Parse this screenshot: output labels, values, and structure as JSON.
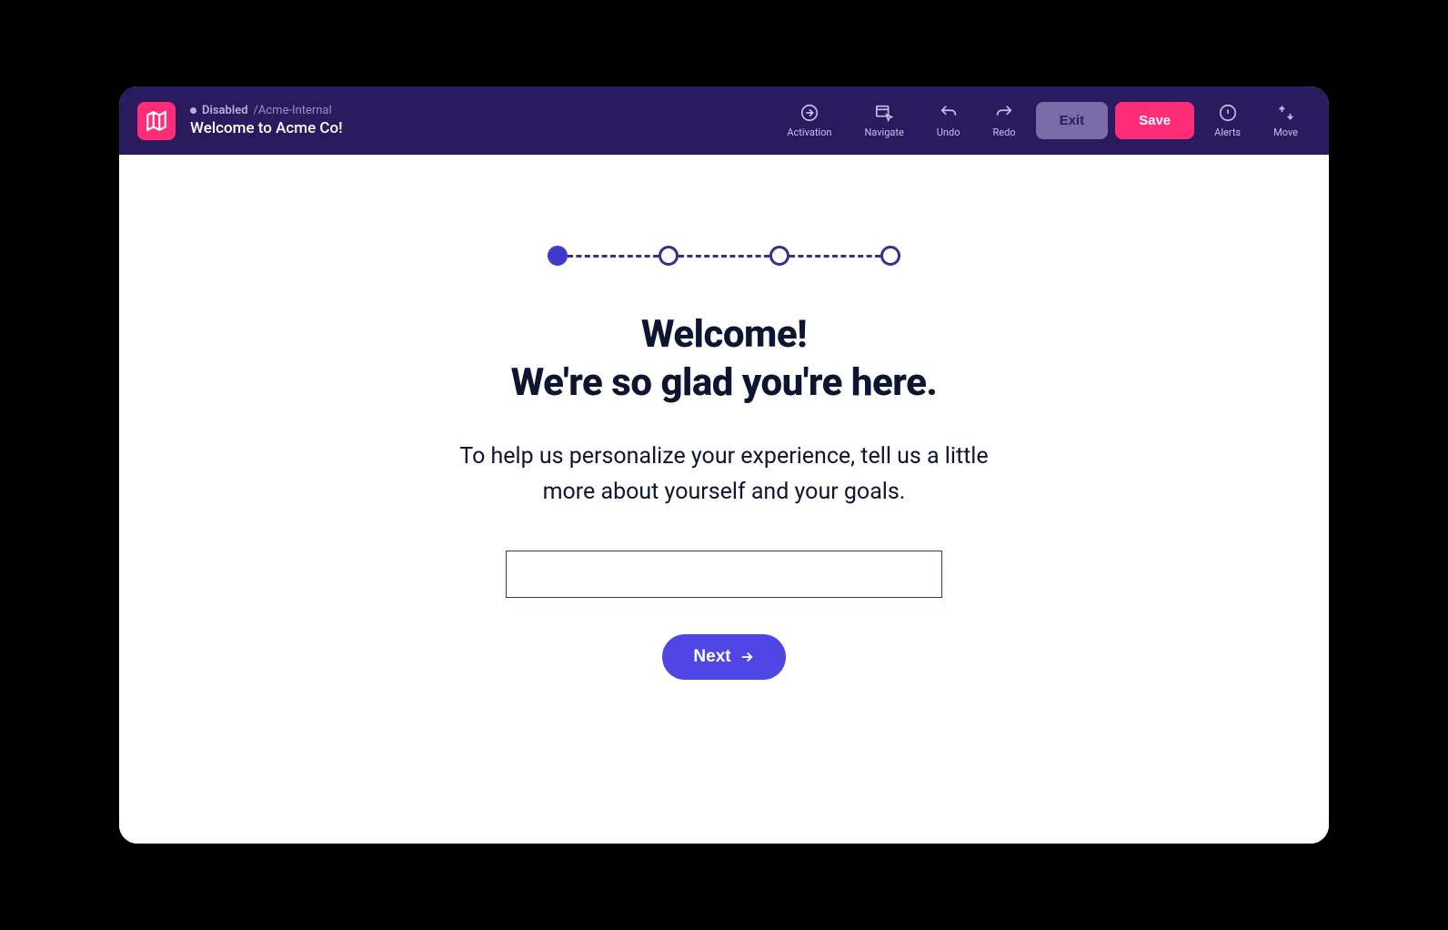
{
  "header": {
    "status_label": "Disabled",
    "breadcrumb": "/Acme-Internal",
    "page_title": "Welcome to Acme Co!"
  },
  "toolbar": {
    "activation_label": "Activation",
    "navigate_label": "Navigate",
    "undo_label": "Undo",
    "redo_label": "Redo",
    "exit_label": "Exit",
    "save_label": "Save",
    "alerts_label": "Alerts",
    "move_label": "Move"
  },
  "stepper": {
    "total_steps": 4,
    "current_step": 1
  },
  "content": {
    "heading_line1": "Welcome!",
    "heading_line2": "We're so glad you're here.",
    "subheading": "To help us personalize your experience, tell us a little more about yourself and your goals.",
    "input_value": "",
    "next_button_label": "Next"
  }
}
